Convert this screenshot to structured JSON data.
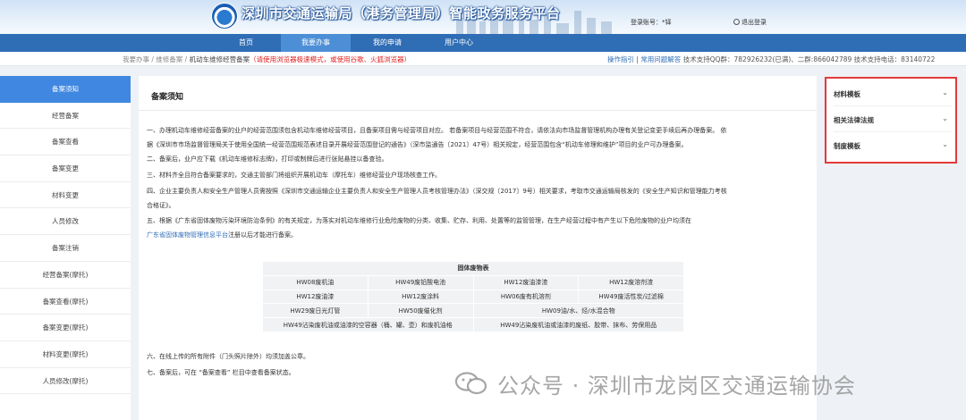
{
  "header": {
    "site_title": "深圳市交通运输局（港务管理局）智能政务服务平台",
    "login_user": "登录账号：*铎",
    "logout_label": "退出登录"
  },
  "nav": {
    "items": [
      "首页",
      "我要办事",
      "我的申请",
      "用户中心"
    ],
    "active": "我要办事"
  },
  "breadcrumb": {
    "path": "我要办事 / 维修备案 / ",
    "current": "机动车维修经营备案",
    "warning": "（请使用浏览器极速模式，或使用谷歌、火狐浏览器）",
    "guide": "操作指引",
    "faq": "常用问题解答",
    "support": "技术支持QQ群：782926232(已满)、二群:866042789  技术支持电话：83140722"
  },
  "sidebar": {
    "items": [
      "备案须知",
      "经营备案",
      "备案查看",
      "备案变更",
      "材料变更",
      "人员修改",
      "备案注销",
      "经营备案(摩托)",
      "备案查看(摩托)",
      "备案变更(摩托)",
      "材料变更(摩托)",
      "人员修改(摩托)"
    ],
    "active_index": 0
  },
  "main": {
    "title": "备案须知",
    "p1a": "一、办理机动车维修经营备案的业户的经营范围须包含机动车维修经营项目，且备案项目需与经营项目对应。 若备案项目与经营范围不符合，请依法向市场监督管理机构办理有关登记变更手续后再办理备案。 依",
    "p1b": "据《深圳市市场监督管理局关于使用全国统一经营范围规范表述目录开展经营范围登记的通告》（深市监通告〔2021〕47号）相关规定，经营范围包含“机动车修理和维护”项目的业户可办理备案。",
    "p2": "二、备案后，业户应下载《机动车维修标志牌》，打印或制牌后进行张贴悬挂以备查验。",
    "p3": "三、材料齐全且符合备案要求的，交通主管部门将组织开展机动车（摩托车）维修经营业户现场核查工作。",
    "p4a": "四、企业主要负责人和安全生产管理人员需按照《深圳市交通运输企业主要负责人和安全生产管理人员考核管理办法》（深交规〔2017〕9号）相关要求，考取市交通运输局核发的《安全生产知识和管理能力考核",
    "p4b": "合格证》。",
    "p5a": "五、根据《广东省固体废物污染环境防治条例》的有关规定，为落实对机动车维修行业危险废物的分类、收集、贮存、利用、处置等的监管管理，在生产经营过程中有产生以下危险废物的业户均须在",
    "p5_link": "广东省固体废物管理信息平台",
    "p5_after": "注册以后才能进行备案。",
    "table_title": "固体废物表",
    "table_rows": [
      [
        "HW08废机油",
        "HW49废铅酸电池",
        "HW12废油漆渣",
        "HW12废溶剂渣"
      ],
      [
        "HW12废油漆",
        "HW12废涂料",
        "HW06废有机溶剂",
        "HW49废活性炭/过滤棉"
      ],
      [
        "HW29废日光灯管",
        "HW50废催化剂",
        "HW09油/水、烃/水混合物"
      ],
      [
        "HW49沾染废机油或油漆的空容器（桶、罐、壶）和废机油格",
        "HW49沾染废机油或油漆的废纸、胶带、抹布、劳保用品"
      ]
    ],
    "p6": "六、在线上传的所有附件（门头照片除外）均须加盖公章。",
    "p7": "七、备案后，可在 “备案查看” 栏目中查看备案状态。"
  },
  "right_panel": {
    "items": [
      "材料模板",
      "相关法律法规",
      "制度模板"
    ]
  },
  "watermark": {
    "text": "公众号 · 深圳市龙岗区交通运输协会"
  },
  "colors": {
    "nav_bg": "#2f6db5",
    "sidebar_active": "#3f87e0",
    "warning": "#e02020",
    "highlight_border": "#e23a3a"
  }
}
